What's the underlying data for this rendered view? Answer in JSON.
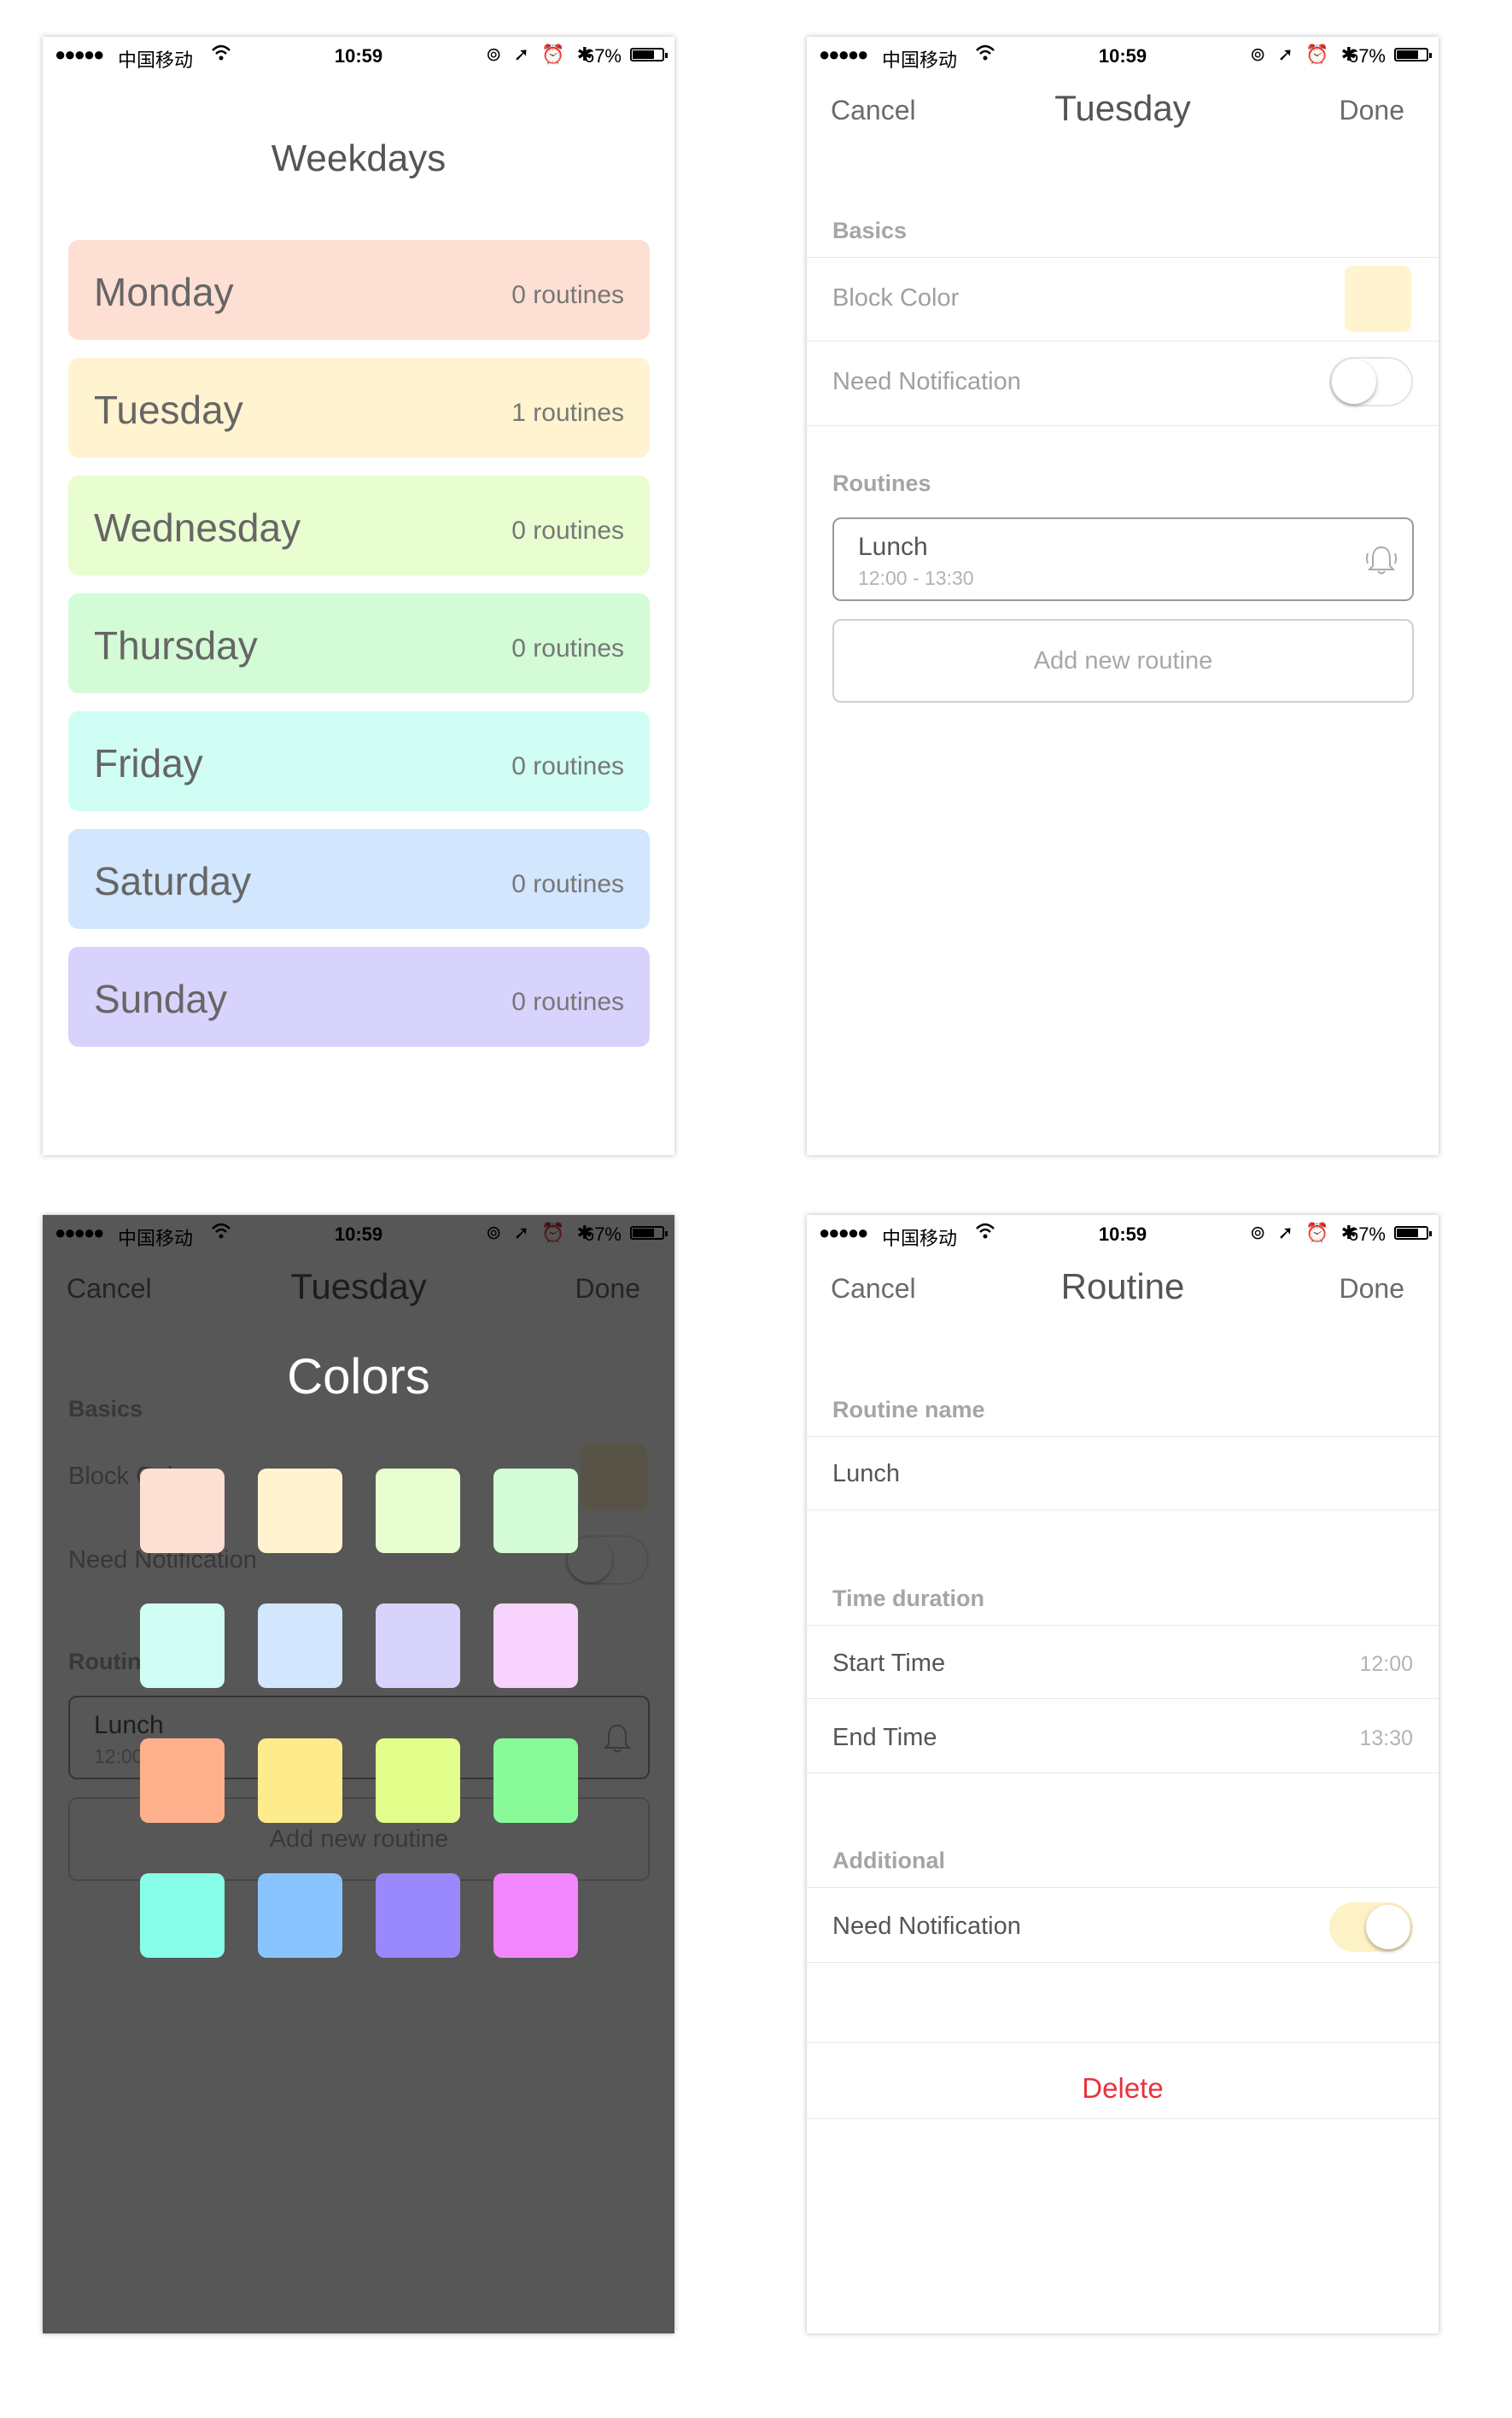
{
  "status_bar": {
    "signal": "●●●●●",
    "carrier": "中国移动",
    "wifi_icon": "wifi-icon",
    "time": "10:59",
    "icons": "⊚ ➚ ⏰ ✱",
    "battery": "67%"
  },
  "weekdays_screen": {
    "title": "Weekdays",
    "days": [
      {
        "name": "Monday",
        "count": "0 routines",
        "color": "#fde0d3"
      },
      {
        "name": "Tuesday",
        "count": "1 routines",
        "color": "#fff4cf"
      },
      {
        "name": "Wednesday",
        "count": "0 routines",
        "color": "#e8fdd0"
      },
      {
        "name": "Thursday",
        "count": "0 routines",
        "color": "#d3fbd6"
      },
      {
        "name": "Friday",
        "count": "0 routines",
        "color": "#d0fef4"
      },
      {
        "name": "Saturday",
        "count": "0 routines",
        "color": "#d2e6fe"
      },
      {
        "name": "Sunday",
        "count": "0 routines",
        "color": "#d7d3fd"
      }
    ]
  },
  "day_screen": {
    "cancel": "Cancel",
    "title": "Tuesday",
    "done": "Done",
    "basics_header": "Basics",
    "block_color_label": "Block Color",
    "block_color_value": "#fff4cf",
    "need_notification_label": "Need Notification",
    "need_notification_on": false,
    "routines_header": "Routines",
    "routine": {
      "name": "Lunch",
      "time": "12:00 - 13:30",
      "icon": "bell-icon"
    },
    "add_routine": "Add new routine"
  },
  "colors_screen": {
    "title": "Colors",
    "swatches": [
      "#fde0d3",
      "#fff4cf",
      "#e8fdd0",
      "#d3fbd6",
      "#d0fef4",
      "#d2e6fe",
      "#d7d3fd",
      "#f8d3fd",
      "#feb08c",
      "#feeb8b",
      "#e3fe8a",
      "#88fb98",
      "#88fee9",
      "#89c4fe",
      "#9a88fd",
      "#f186fd"
    ]
  },
  "routine_screen": {
    "cancel": "Cancel",
    "title": "Routine",
    "done": "Done",
    "name_header": "Routine name",
    "name_value": "Lunch",
    "duration_header": "Time duration",
    "start_label": "Start Time",
    "start_value": "12:00",
    "end_label": "End Time",
    "end_value": "13:30",
    "additional_header": "Additional",
    "need_notification_label": "Need Notification",
    "need_notification_on": true,
    "delete": "Delete"
  }
}
